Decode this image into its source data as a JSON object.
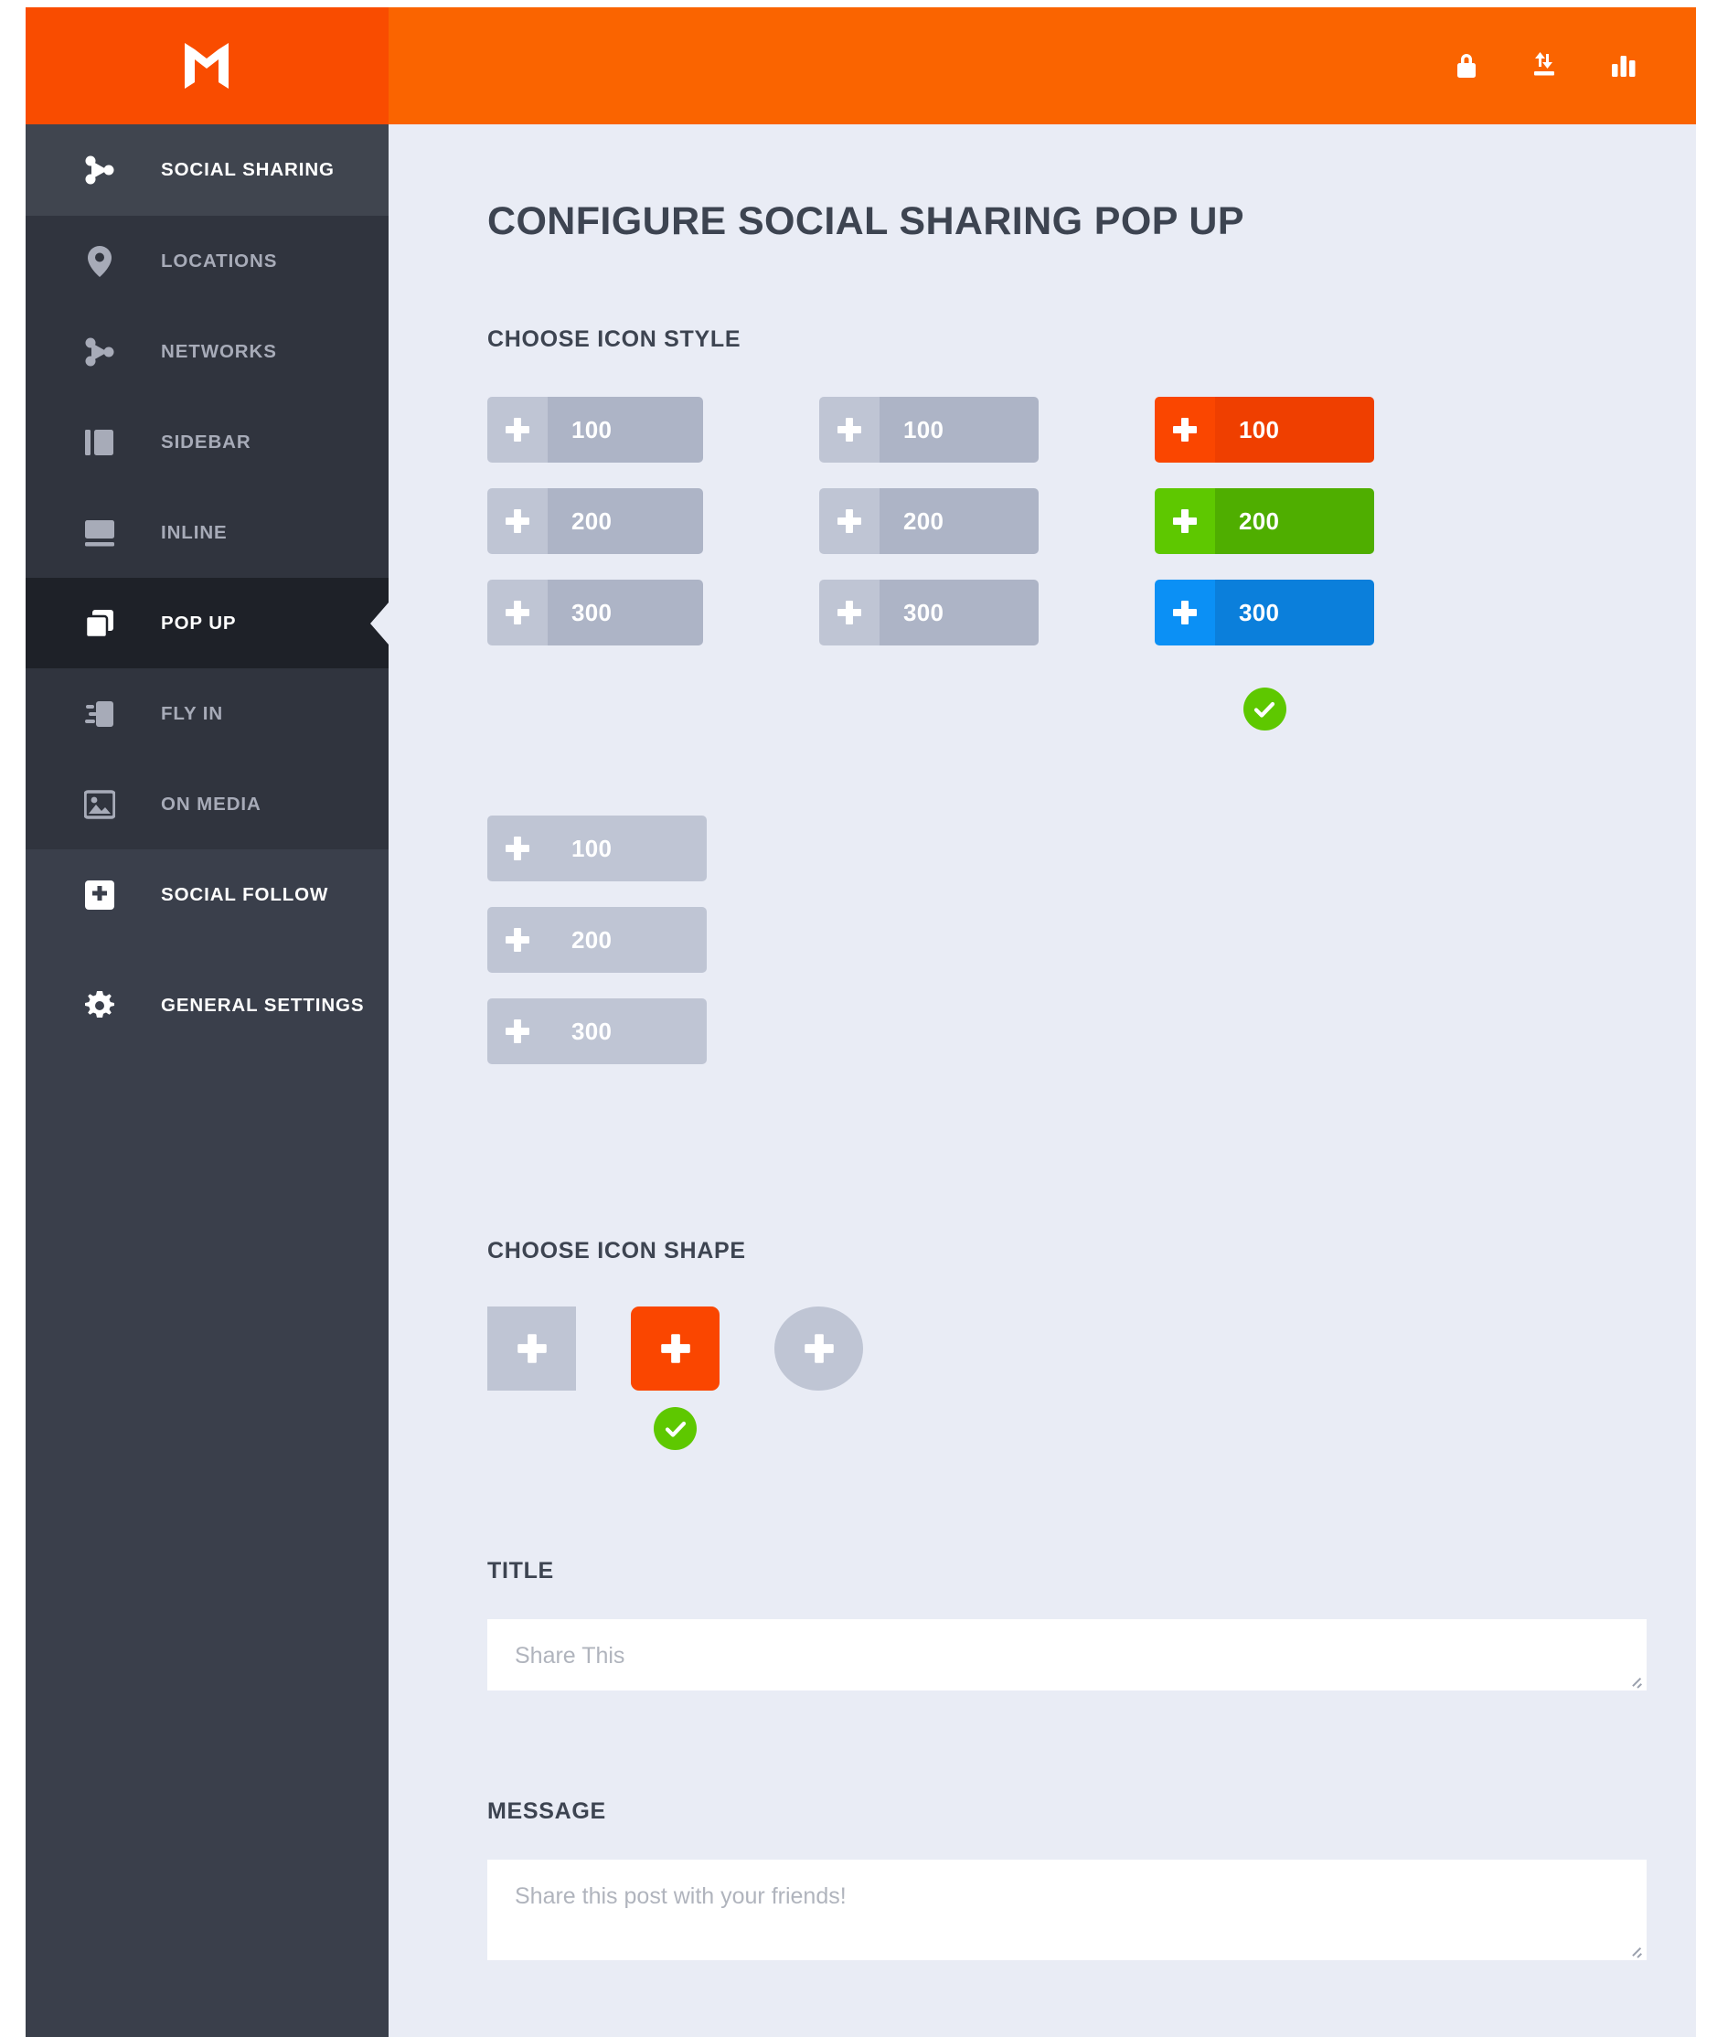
{
  "header": {
    "logo_icon": "m-logo-icon",
    "actions": [
      {
        "icon": "lock-icon",
        "name": "lock-button"
      },
      {
        "icon": "import-export-icon",
        "name": "import-export-button"
      },
      {
        "icon": "bar-chart-icon",
        "name": "analytics-button"
      }
    ]
  },
  "sidebar": {
    "items": [
      {
        "label": "SOCIAL SHARING",
        "icon": "share-network-icon",
        "state": "top"
      },
      {
        "label": "LOCATIONS",
        "icon": "map-pin-icon",
        "state": "sub"
      },
      {
        "label": "NETWORKS",
        "icon": "share-network-icon",
        "state": "sub"
      },
      {
        "label": "SIDEBAR",
        "icon": "sidebar-panel-icon",
        "state": "sub"
      },
      {
        "label": "INLINE",
        "icon": "inline-block-icon",
        "state": "sub"
      },
      {
        "label": "POP UP",
        "icon": "popup-windows-icon",
        "state": "active"
      },
      {
        "label": "FLY IN",
        "icon": "fly-in-icon",
        "state": "sub"
      },
      {
        "label": "ON MEDIA",
        "icon": "image-icon",
        "state": "sub"
      },
      {
        "label": "SOCIAL FOLLOW",
        "icon": "plus-square-icon",
        "state": "bold"
      },
      {
        "label": "GENERAL SETTINGS",
        "icon": "gear-icon",
        "state": "bold"
      }
    ]
  },
  "main": {
    "page_title": "CONFIGURE SOCIAL SHARING POP UP",
    "icon_style": {
      "label": "CHOOSE ICON STYLE",
      "columns": [
        {
          "name": "style-option-1",
          "selected": false,
          "buttons": [
            {
              "count": "100"
            },
            {
              "count": "200"
            },
            {
              "count": "300"
            }
          ]
        },
        {
          "name": "style-option-2",
          "selected": false,
          "buttons": [
            {
              "count": "100"
            },
            {
              "count": "200"
            },
            {
              "count": "300"
            }
          ]
        },
        {
          "name": "style-option-3",
          "selected": true,
          "buttons": [
            {
              "count": "100",
              "color": "#fa4600"
            },
            {
              "count": "200",
              "color": "#5ec800"
            },
            {
              "count": "300",
              "color": "#0b90f5"
            }
          ]
        }
      ],
      "fourth_option": {
        "name": "style-option-4",
        "selected": false,
        "buttons": [
          {
            "count": "100"
          },
          {
            "count": "200"
          },
          {
            "count": "300"
          }
        ]
      }
    },
    "icon_shape": {
      "label": "CHOOSE ICON SHAPE",
      "options": [
        {
          "name": "shape-square",
          "shape": "square",
          "selected": false
        },
        {
          "name": "shape-rounded",
          "shape": "rounded-square",
          "selected": true,
          "color": "#fa4600"
        },
        {
          "name": "shape-circle",
          "shape": "circle",
          "selected": false
        }
      ]
    },
    "title_field": {
      "label": "TITLE",
      "value": "",
      "placeholder": "Share This"
    },
    "message_field": {
      "label": "MESSAGE",
      "value": "",
      "placeholder": "Share this post with your friends!"
    }
  },
  "colors": {
    "brand_orange": "#fa6400",
    "logo_orange": "#f94c00",
    "sidebar": "#3a3f4b",
    "sidebar_sub": "#30343e",
    "sidebar_active": "#1e2128",
    "canvas": "#e9ecf5",
    "accent_green": "#5ec800",
    "accent_blue": "#0b90f5"
  }
}
